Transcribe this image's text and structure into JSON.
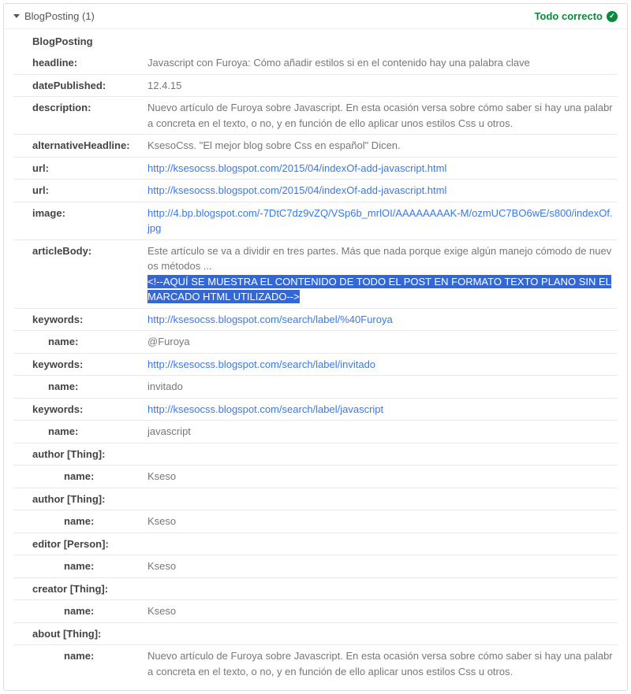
{
  "header": {
    "title": "BlogPosting (1)",
    "status": "Todo correcto"
  },
  "typeHeader": "BlogPosting",
  "rows": [
    {
      "key": "headline:",
      "indent": 0,
      "text": "Javascript con Furoya: Cómo añadir estilos si en el contenido hay una palabra clave",
      "link": false
    },
    {
      "key": "datePublished:",
      "indent": 0,
      "text": "12.4.15",
      "link": false
    },
    {
      "key": "description:",
      "indent": 0,
      "text": "Nuevo artículo de Furoya sobre Javascript. En esta ocasión versa sobre cómo saber si hay una palabra concreta en el texto, o no, y en función de ello aplicar unos estilos Css u otros.",
      "link": false
    },
    {
      "key": "alternativeHeadline:",
      "indent": 0,
      "text": "KsesoCss. \"El mejor blog sobre Css en español\" Dicen.",
      "link": false
    },
    {
      "key": "url:",
      "indent": 0,
      "text": "http://ksesocss.blogspot.com/2015/04/indexOf-add-javascript.html",
      "link": true
    },
    {
      "key": "url:",
      "indent": 0,
      "text": "http://ksesocss.blogspot.com/2015/04/indexOf-add-javascript.html",
      "link": true
    },
    {
      "key": "image:",
      "indent": 0,
      "text": "http://4.bp.blogspot.com/-7DtC7dz9vZQ/VSp6b_mrlOI/AAAAAAAAK-M/ozmUC7BO6wE/s800/indexOf.jpg",
      "link": true
    },
    {
      "key": "articleBody:",
      "indent": 0,
      "text": "Este artículo se va a dividir en tres partes. Más que nada porque exige algún manejo cómodo de nuevos métodos ...",
      "highlight": "<!--AQUÍ SE MUESTRA EL CONTENIDO DE TODO EL POST EN FORMATO TEXTO PLANO SIN EL MARCADO HTML UTILIZADO-->",
      "link": false
    },
    {
      "key": "keywords:",
      "indent": 0,
      "text": "http://ksesocss.blogspot.com/search/label/%40Furoya",
      "link": true
    },
    {
      "key": "name:",
      "indent": 1,
      "text": "@Furoya",
      "link": false
    },
    {
      "key": "keywords:",
      "indent": 0,
      "text": "http://ksesocss.blogspot.com/search/label/invitado",
      "link": true
    },
    {
      "key": "name:",
      "indent": 1,
      "text": "invitado",
      "link": false
    },
    {
      "key": "keywords:",
      "indent": 0,
      "text": "http://ksesocss.blogspot.com/search/label/javascript",
      "link": true
    },
    {
      "key": "name:",
      "indent": 1,
      "text": "javascript",
      "link": false
    },
    {
      "key": "author [Thing]:",
      "indent": 0,
      "text": "",
      "link": false
    },
    {
      "key": "name:",
      "indent": 2,
      "text": "Kseso",
      "link": false
    },
    {
      "key": "author [Thing]:",
      "indent": 0,
      "text": "",
      "link": false
    },
    {
      "key": "name:",
      "indent": 2,
      "text": "Kseso",
      "link": false
    },
    {
      "key": "editor [Person]:",
      "indent": 0,
      "text": "",
      "link": false
    },
    {
      "key": "name:",
      "indent": 2,
      "text": "Kseso",
      "link": false
    },
    {
      "key": "creator [Thing]:",
      "indent": 0,
      "text": "",
      "link": false
    },
    {
      "key": "name:",
      "indent": 2,
      "text": "Kseso",
      "link": false
    },
    {
      "key": "about [Thing]:",
      "indent": 0,
      "text": "",
      "link": false
    },
    {
      "key": "name:",
      "indent": 2,
      "text": "Nuevo artículo de Furoya sobre Javascript. En esta ocasión versa sobre cómo saber si hay una palabra concreta en el texto, o no, y en función de ello aplicar unos estilos Css u otros.",
      "link": false
    }
  ]
}
